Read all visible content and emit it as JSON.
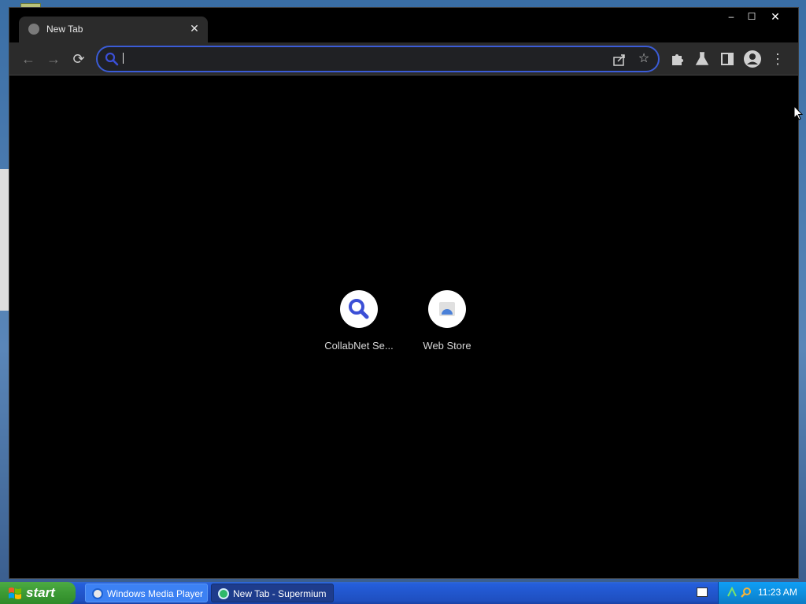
{
  "browser": {
    "tab": {
      "title": "New Tab",
      "close": "✕"
    },
    "window_controls": {
      "minimize": "–",
      "maximize": "☐",
      "close": "✕"
    },
    "toolbar": {
      "back": "←",
      "forward": "→",
      "reload": "⟳",
      "star": "☆",
      "menu": "⋮"
    },
    "omnibox": {
      "value": "",
      "placeholder": ""
    }
  },
  "ntp": {
    "shortcuts": [
      {
        "label": "CollabNet Se...",
        "icon": "search-icon"
      },
      {
        "label": "Web Store",
        "icon": "webstore-icon"
      }
    ]
  },
  "taskbar": {
    "start_label": "start",
    "tasks": [
      {
        "label": "Windows Media Player",
        "icon": "media-player-icon"
      },
      {
        "label": "New Tab - Supermium",
        "icon": "browser-icon"
      }
    ],
    "clock": "11:23 AM"
  },
  "colors": {
    "omnibox_border": "#3b5cd7",
    "search_blue": "#3b4fd6",
    "tab_bg": "#2b2b2b"
  }
}
